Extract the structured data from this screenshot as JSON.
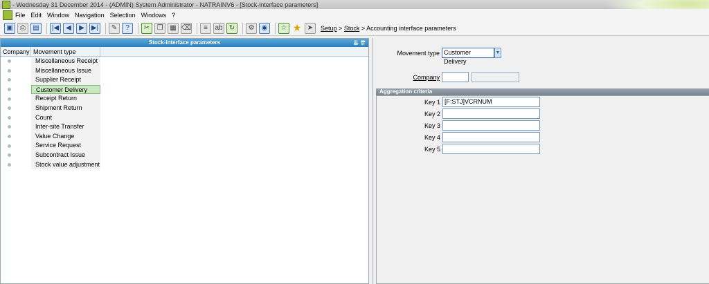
{
  "window": {
    "title": "- Wednesday 31 December 2014 - (ADMIN) System Administrator - NATRAINV6 - [Stock-interface parameters]"
  },
  "menu": {
    "items": [
      "File",
      "Edit",
      "Window",
      "Navigation",
      "Selection",
      "Windows",
      "?"
    ]
  },
  "breadcrumb": {
    "setup": "Setup",
    "sep1": ">",
    "stock": "Stock",
    "sep2": ">",
    "current": "Accounting interface parameters"
  },
  "left_panel": {
    "title": "Stock-interface parameters",
    "columns": [
      "Company",
      "Movement type"
    ],
    "rows": [
      "Miscellaneous Receipt",
      "Miscellaneous Issue",
      "Supplier Receipt",
      "Customer Delivery",
      "Receipt Return",
      "Shipment Return",
      "Count",
      "Inter-site Transfer",
      "Value Change",
      "Service Request",
      "Subcontract Issue",
      "Stock value adjustment"
    ],
    "selected_index": 3
  },
  "form": {
    "movement_type_label": "Movement type",
    "movement_type_value": "Customer Delivery",
    "company_label": "Company",
    "company_value": "",
    "company_desc": "",
    "aggregation_title": "Aggregation criteria",
    "keys": [
      {
        "label": "Key 1",
        "value": "[F:STJ]VCRNUM"
      },
      {
        "label": "Key 2",
        "value": ""
      },
      {
        "label": "Key 3",
        "value": ""
      },
      {
        "label": "Key 4",
        "value": ""
      },
      {
        "label": "Key 5",
        "value": ""
      }
    ]
  }
}
